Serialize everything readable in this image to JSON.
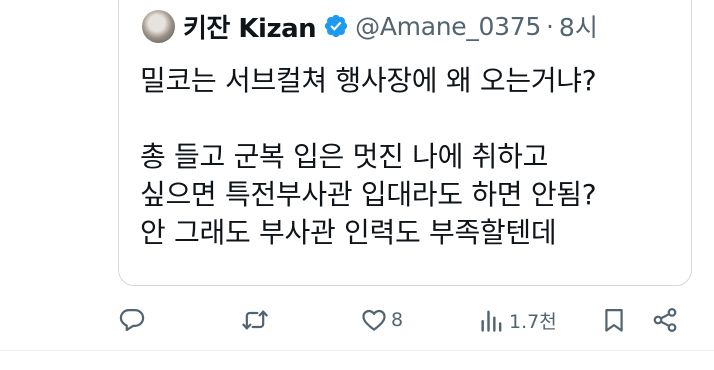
{
  "quoted_tweet": {
    "author": {
      "display_name": "키잔 Kizan",
      "handle": "@Amane_0375",
      "separator": "·",
      "time": "8시",
      "verified": true
    },
    "text_lines": [
      "밀코는 서브컬쳐 행사장에 왜 오는거냐?",
      "",
      "총 들고 군복 입은 멋진 나에 취하고",
      "싶으면 특전부사관 입대라도 하면 안됨?",
      "안 그래도 부사관 인력도 부족할텐데"
    ]
  },
  "actions": {
    "reply": {
      "icon": "reply-icon",
      "count": ""
    },
    "repost": {
      "icon": "repost-icon",
      "count": ""
    },
    "like": {
      "icon": "heart-icon",
      "count": "8"
    },
    "views": {
      "icon": "views-icon",
      "count": "1.7천"
    },
    "bookmark": {
      "icon": "bookmark-icon"
    },
    "share": {
      "icon": "share-icon"
    }
  },
  "colors": {
    "verified": "#1d9bf0",
    "muted_text": "#536471",
    "text": "#0f1419",
    "border": "#cfd9de"
  }
}
